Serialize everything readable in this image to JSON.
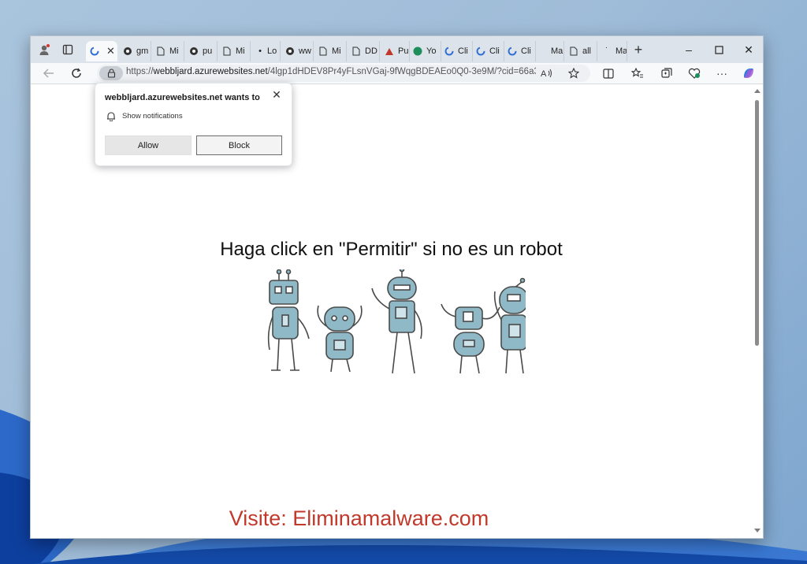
{
  "browser": {
    "tabs": [
      {
        "label": "",
        "active": true
      },
      {
        "label": "gm"
      },
      {
        "label": "Mi"
      },
      {
        "label": "pu"
      },
      {
        "label": "Mi"
      },
      {
        "label": "Lo"
      },
      {
        "label": "ww"
      },
      {
        "label": "Mi"
      },
      {
        "label": "DD"
      },
      {
        "label": "Pu"
      },
      {
        "label": "Yo"
      },
      {
        "label": "Cli"
      },
      {
        "label": "Cli"
      },
      {
        "label": "Cli"
      },
      {
        "label": "Ma"
      },
      {
        "label": "all"
      },
      {
        "label": "Ma"
      }
    ],
    "url": {
      "scheme": "https://",
      "domain": "webbljard.azurewebsites.net",
      "path": "/4lgp1dHDEV8Pr4yFLsnVGaj-9fWqgBDEAEo0Q0-3e9M/?cid=66a3..."
    }
  },
  "popup": {
    "title": "webbljard.azurewebsites.net wants to",
    "permission": "Show notifications",
    "allow_label": "Allow",
    "block_label": "Block"
  },
  "page": {
    "headline": "Haga click en \"Permitir\" si no es un robot"
  },
  "watermark": "Visite: Eliminamalware.com",
  "colors": {
    "watermark": "#c0392b",
    "scroll_thumb": "#8c8c8c",
    "robot_body": "#8fb9c6"
  }
}
